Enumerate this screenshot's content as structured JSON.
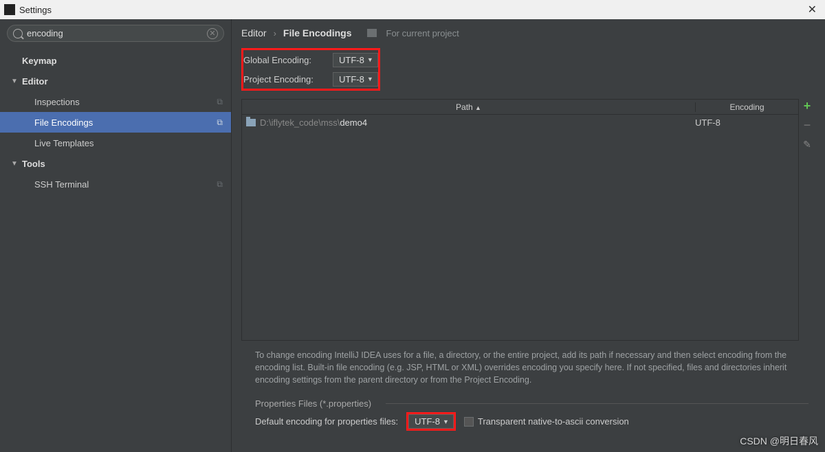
{
  "window": {
    "title": "Settings"
  },
  "search": {
    "value": "encoding"
  },
  "sidebar": {
    "items": [
      {
        "label": "Keymap",
        "type": "bold"
      },
      {
        "label": "Editor",
        "type": "bold-exp"
      },
      {
        "label": "Inspections",
        "type": "sub",
        "icon": true
      },
      {
        "label": "File Encodings",
        "type": "sub",
        "icon": true,
        "selected": true
      },
      {
        "label": "Live Templates",
        "type": "sub"
      },
      {
        "label": "Tools",
        "type": "bold-exp"
      },
      {
        "label": "SSH Terminal",
        "type": "sub",
        "icon": true
      }
    ]
  },
  "breadcrumbs": {
    "a": "Editor",
    "b": "File Encodings",
    "badge": "For current project"
  },
  "form": {
    "global_label": "Global Encoding:",
    "global_value": "UTF-8",
    "project_label": "Project Encoding:",
    "project_value": "UTF-8"
  },
  "table": {
    "head_path": "Path",
    "head_enc": "Encoding",
    "rows": [
      {
        "path_dim": "D:\\iflytek_code\\mss\\",
        "path_bright": "demo4",
        "encoding": "UTF-8"
      }
    ]
  },
  "info": "To change encoding IntelliJ IDEA uses for a file, a directory, or the entire project, add its path if necessary and then select encoding from the encoding list. Built-in file encoding (e.g. JSP, HTML or XML) overrides encoding you specify here. If not specified, files and directories inherit encoding settings from the parent directory or from the Project Encoding.",
  "props": {
    "section": "Properties Files (*.properties)",
    "label": "Default encoding for properties files:",
    "value": "UTF-8",
    "checkbox": "Transparent native-to-ascii conversion"
  },
  "watermark": "CSDN @明日春风"
}
